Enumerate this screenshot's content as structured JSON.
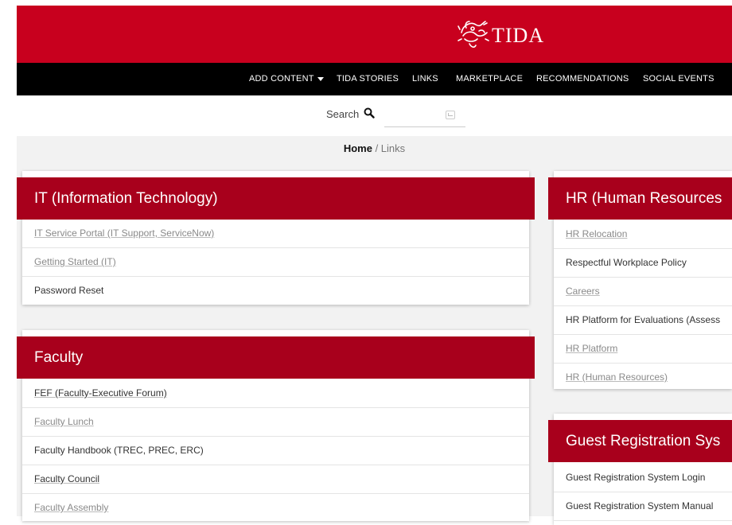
{
  "header": {
    "logo_text": "TIDA",
    "logo_icon": "dragon-emblem-icon"
  },
  "nav": {
    "items": [
      {
        "label": "ADD CONTENT",
        "dropdown": true
      },
      {
        "label": "TIDA STORIES"
      },
      {
        "label": "LINKS"
      },
      {
        "label": "MARKETPLACE"
      },
      {
        "label": "RECOMMENDATIONS"
      },
      {
        "label": "SOCIAL EVENTS"
      }
    ]
  },
  "search": {
    "label": "Search",
    "placeholder": ""
  },
  "breadcrumb": {
    "home": "Home",
    "separator": " / ",
    "current": "Links"
  },
  "colors": {
    "header_red": "#c8001e",
    "card_red": "#a8001c",
    "nav_black": "#000000"
  },
  "cards": {
    "it": {
      "title": "IT (Information Technology)",
      "items": [
        "IT Service Portal (IT Support, ServiceNow)",
        "Getting Started (IT)",
        "Password Reset"
      ]
    },
    "faculty": {
      "title": "Faculty",
      "items": [
        "FEF (Faculty-Executive Forum)",
        "Faculty Lunch",
        "Faculty Handbook (TREC, PREC, ERC)",
        "Faculty Council",
        "Faculty Assembly"
      ]
    },
    "hr": {
      "title": "HR (Human Resources",
      "items": [
        "HR Relocation",
        "Respectful Workplace Policy",
        "Careers",
        "HR Platform for Evaluations (Assess",
        "HR Platform",
        "HR (Human Resources)"
      ]
    },
    "guest": {
      "title": "Guest Registration Sys",
      "items": [
        "Guest Registration System Login",
        "Guest Registration System Manual"
      ]
    }
  }
}
